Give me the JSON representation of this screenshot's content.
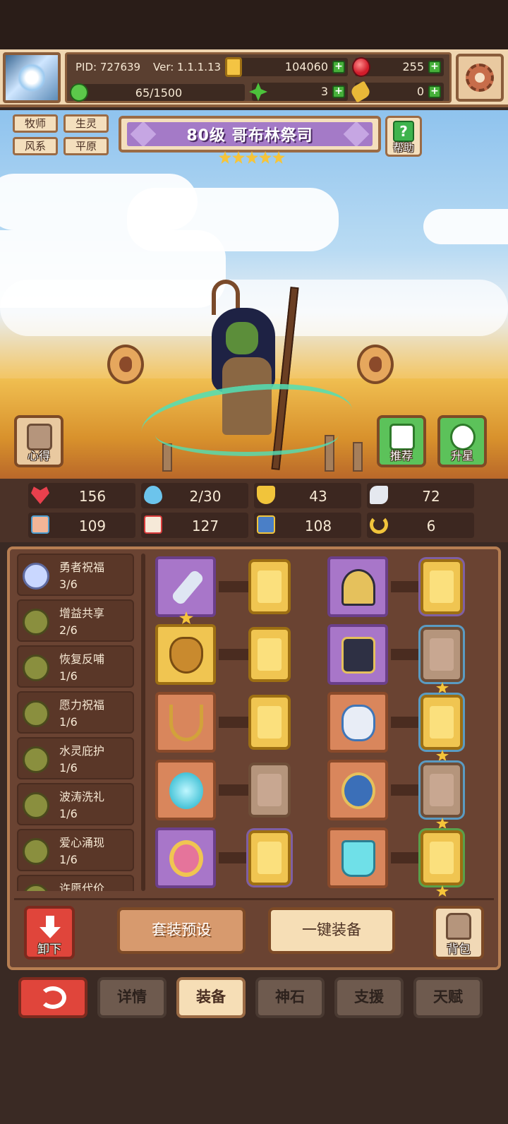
{
  "topbar": {
    "pid": "PID: 727639",
    "version": "Ver: 1.1.1.13",
    "coins": "104060",
    "gems": "255",
    "stamina": "65/1500",
    "stamina_fraction": 0.043,
    "clovers": "3",
    "keys": "0"
  },
  "hero": {
    "tags": [
      "牧师",
      "生灵",
      "风系",
      "平原"
    ],
    "title": "80级  哥布林祭司",
    "star_count": 5,
    "help_label": "帮助",
    "insight_label": "心得",
    "recommend_label": "推荐",
    "star_up_label": "升星"
  },
  "stats": {
    "hp": "156",
    "mana": "2/30",
    "defense": "43",
    "speed": "72",
    "attack": "109",
    "magic": "127",
    "crit": "108",
    "luck": "6"
  },
  "sets": [
    {
      "name": "勇者祝福",
      "count": "3/6"
    },
    {
      "name": "增益共享",
      "count": "2/6"
    },
    {
      "name": "恢复反哺",
      "count": "1/6"
    },
    {
      "name": "愿力祝福",
      "count": "1/6"
    },
    {
      "name": "水灵庇护",
      "count": "1/6"
    },
    {
      "name": "波涛洗礼",
      "count": "1/6"
    },
    {
      "name": "爱心涌现",
      "count": "1/6"
    },
    {
      "name": "许愿代价",
      "count": ""
    }
  ],
  "actions": {
    "unequip_label": "卸下",
    "preset_label": "套装预设",
    "one_click_label": "一键装备",
    "bag_label": "背包"
  },
  "tabs": [
    {
      "label": "详情"
    },
    {
      "label": "装备"
    },
    {
      "label": "神石"
    },
    {
      "label": "支援"
    },
    {
      "label": "天赋"
    }
  ],
  "colors": {
    "accent_red": "#e0453b",
    "panel_brown": "#6a4332",
    "title_purple": "#a47ac7",
    "star_gold": "#f5c43a"
  }
}
